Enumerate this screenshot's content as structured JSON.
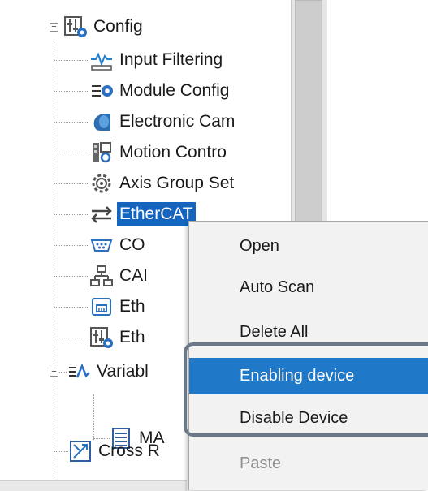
{
  "tree": {
    "root": {
      "label": "Config",
      "icon": "config-icon"
    },
    "children": [
      {
        "label": "Input Filtering",
        "icon": "input-filtering-icon"
      },
      {
        "label": "Module Config",
        "icon": "module-config-icon"
      },
      {
        "label": "Electronic Cam",
        "icon": "electronic-cam-icon"
      },
      {
        "label": "Motion Contro",
        "icon": "motion-control-icon"
      },
      {
        "label": "Axis Group Set",
        "icon": "axis-group-icon"
      },
      {
        "label": "EtherCAT",
        "icon": "ethercat-icon"
      },
      {
        "label": "CO",
        "icon": "com-icon"
      },
      {
        "label": "CAI",
        "icon": "can-icon"
      },
      {
        "label": "Eth",
        "icon": "ethernet-icon"
      },
      {
        "label": "Eth",
        "icon": "ethernet-config-icon"
      }
    ],
    "variable": {
      "label": "Variabl",
      "icon": "variable-icon"
    },
    "variable_child": {
      "label": "MA",
      "icon": "table-icon"
    },
    "cross": {
      "label": "Cross R",
      "icon": "cross-reference-icon"
    }
  },
  "context_menu": {
    "items": [
      {
        "label": "Open",
        "state": "normal"
      },
      {
        "label": "Auto Scan",
        "state": "normal"
      },
      {
        "label": "Delete All",
        "state": "normal"
      },
      {
        "label": "Enabling device",
        "state": "highlighted"
      },
      {
        "label": "Disable Device",
        "state": "normal"
      },
      {
        "label": "Paste",
        "state": "disabled"
      }
    ]
  },
  "colors": {
    "selection": "#1565c0",
    "menu_highlight": "#1f78c8",
    "callout_border": "#6b7888"
  }
}
